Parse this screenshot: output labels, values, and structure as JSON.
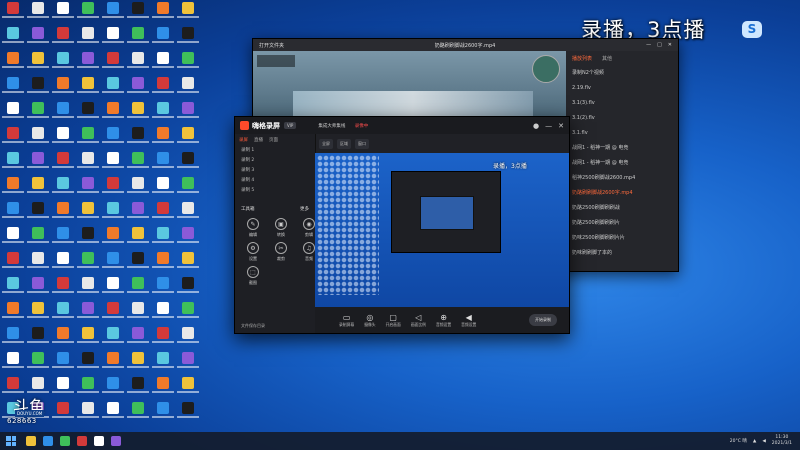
{
  "overlay_title": "录播，3点播",
  "player": {
    "window_label": "打开文件夹",
    "title": "奶酪刷刷脚战2600字.mp4",
    "controls": [
      "—",
      "□",
      "✕"
    ],
    "playlist_tabs": [
      "播放列表",
      "其他"
    ],
    "playlist": [
      "录制N2个视频",
      "2.19.flv",
      "3.1(3).flv",
      "3.1(2).flv",
      "3.1.flv",
      "战网1 - 稻神一期 @ 电竞",
      "战网1 - 稻神一期 @ 电竞",
      "稻神2500刷脚战2600.mp4",
      "奶酪刷刷脚战2600字.mp4",
      "奶酪2500刷脚刷刷战",
      "奶酪2500刷脚刷刷片",
      "奶味2500刷脚刷刷片片",
      "奶味刷刷脚了本的"
    ],
    "active_index": 8
  },
  "recorder": {
    "brand": "嗨格录屏",
    "badge": "VIP",
    "info": "集成大师集线",
    "info_red": "录像中",
    "side_tabs": [
      "录屏",
      "直播",
      "页面"
    ],
    "side_rows": [
      "录制 1",
      "录制 2",
      "录制 3",
      "录制 4",
      "录制 5"
    ],
    "tools_title": "工具箱",
    "tools_more": "更多",
    "tools": [
      {
        "icon": "✎",
        "label": "编辑"
      },
      {
        "icon": "▣",
        "label": "转换"
      },
      {
        "icon": "◉",
        "label": "剪辑"
      },
      {
        "icon": "⚙",
        "label": "设置"
      },
      {
        "icon": "✂",
        "label": "裁剪"
      },
      {
        "icon": "♫",
        "label": "音频"
      },
      {
        "icon": "⬚",
        "label": "截图"
      }
    ],
    "head_pills": [
      "全屏",
      "区域",
      "窗口"
    ],
    "mini_caption": "录播，3点播",
    "footer": "文件保存目录",
    "bar": [
      {
        "icon": "▭",
        "label": "录制屏幕"
      },
      {
        "icon": "◎",
        "label": "摄像头"
      },
      {
        "icon": "▢",
        "label": "开启画面"
      },
      {
        "icon": "◁",
        "label": "画面比例"
      },
      {
        "icon": "⊕",
        "label": "音频设置"
      },
      {
        "icon": "◀",
        "label": "音频设置"
      }
    ],
    "start_label": "开始录制"
  },
  "stream_badge": {
    "logo": "斗鱼",
    "sub": "DOUYU.COM",
    "room_id": "628663"
  },
  "taskbar": {
    "weather": "20°C 晴",
    "time": "11:30",
    "date": "2021/3/1"
  },
  "colors": {
    "accent": "#ff5a3a",
    "desktop": "#1762c9"
  }
}
